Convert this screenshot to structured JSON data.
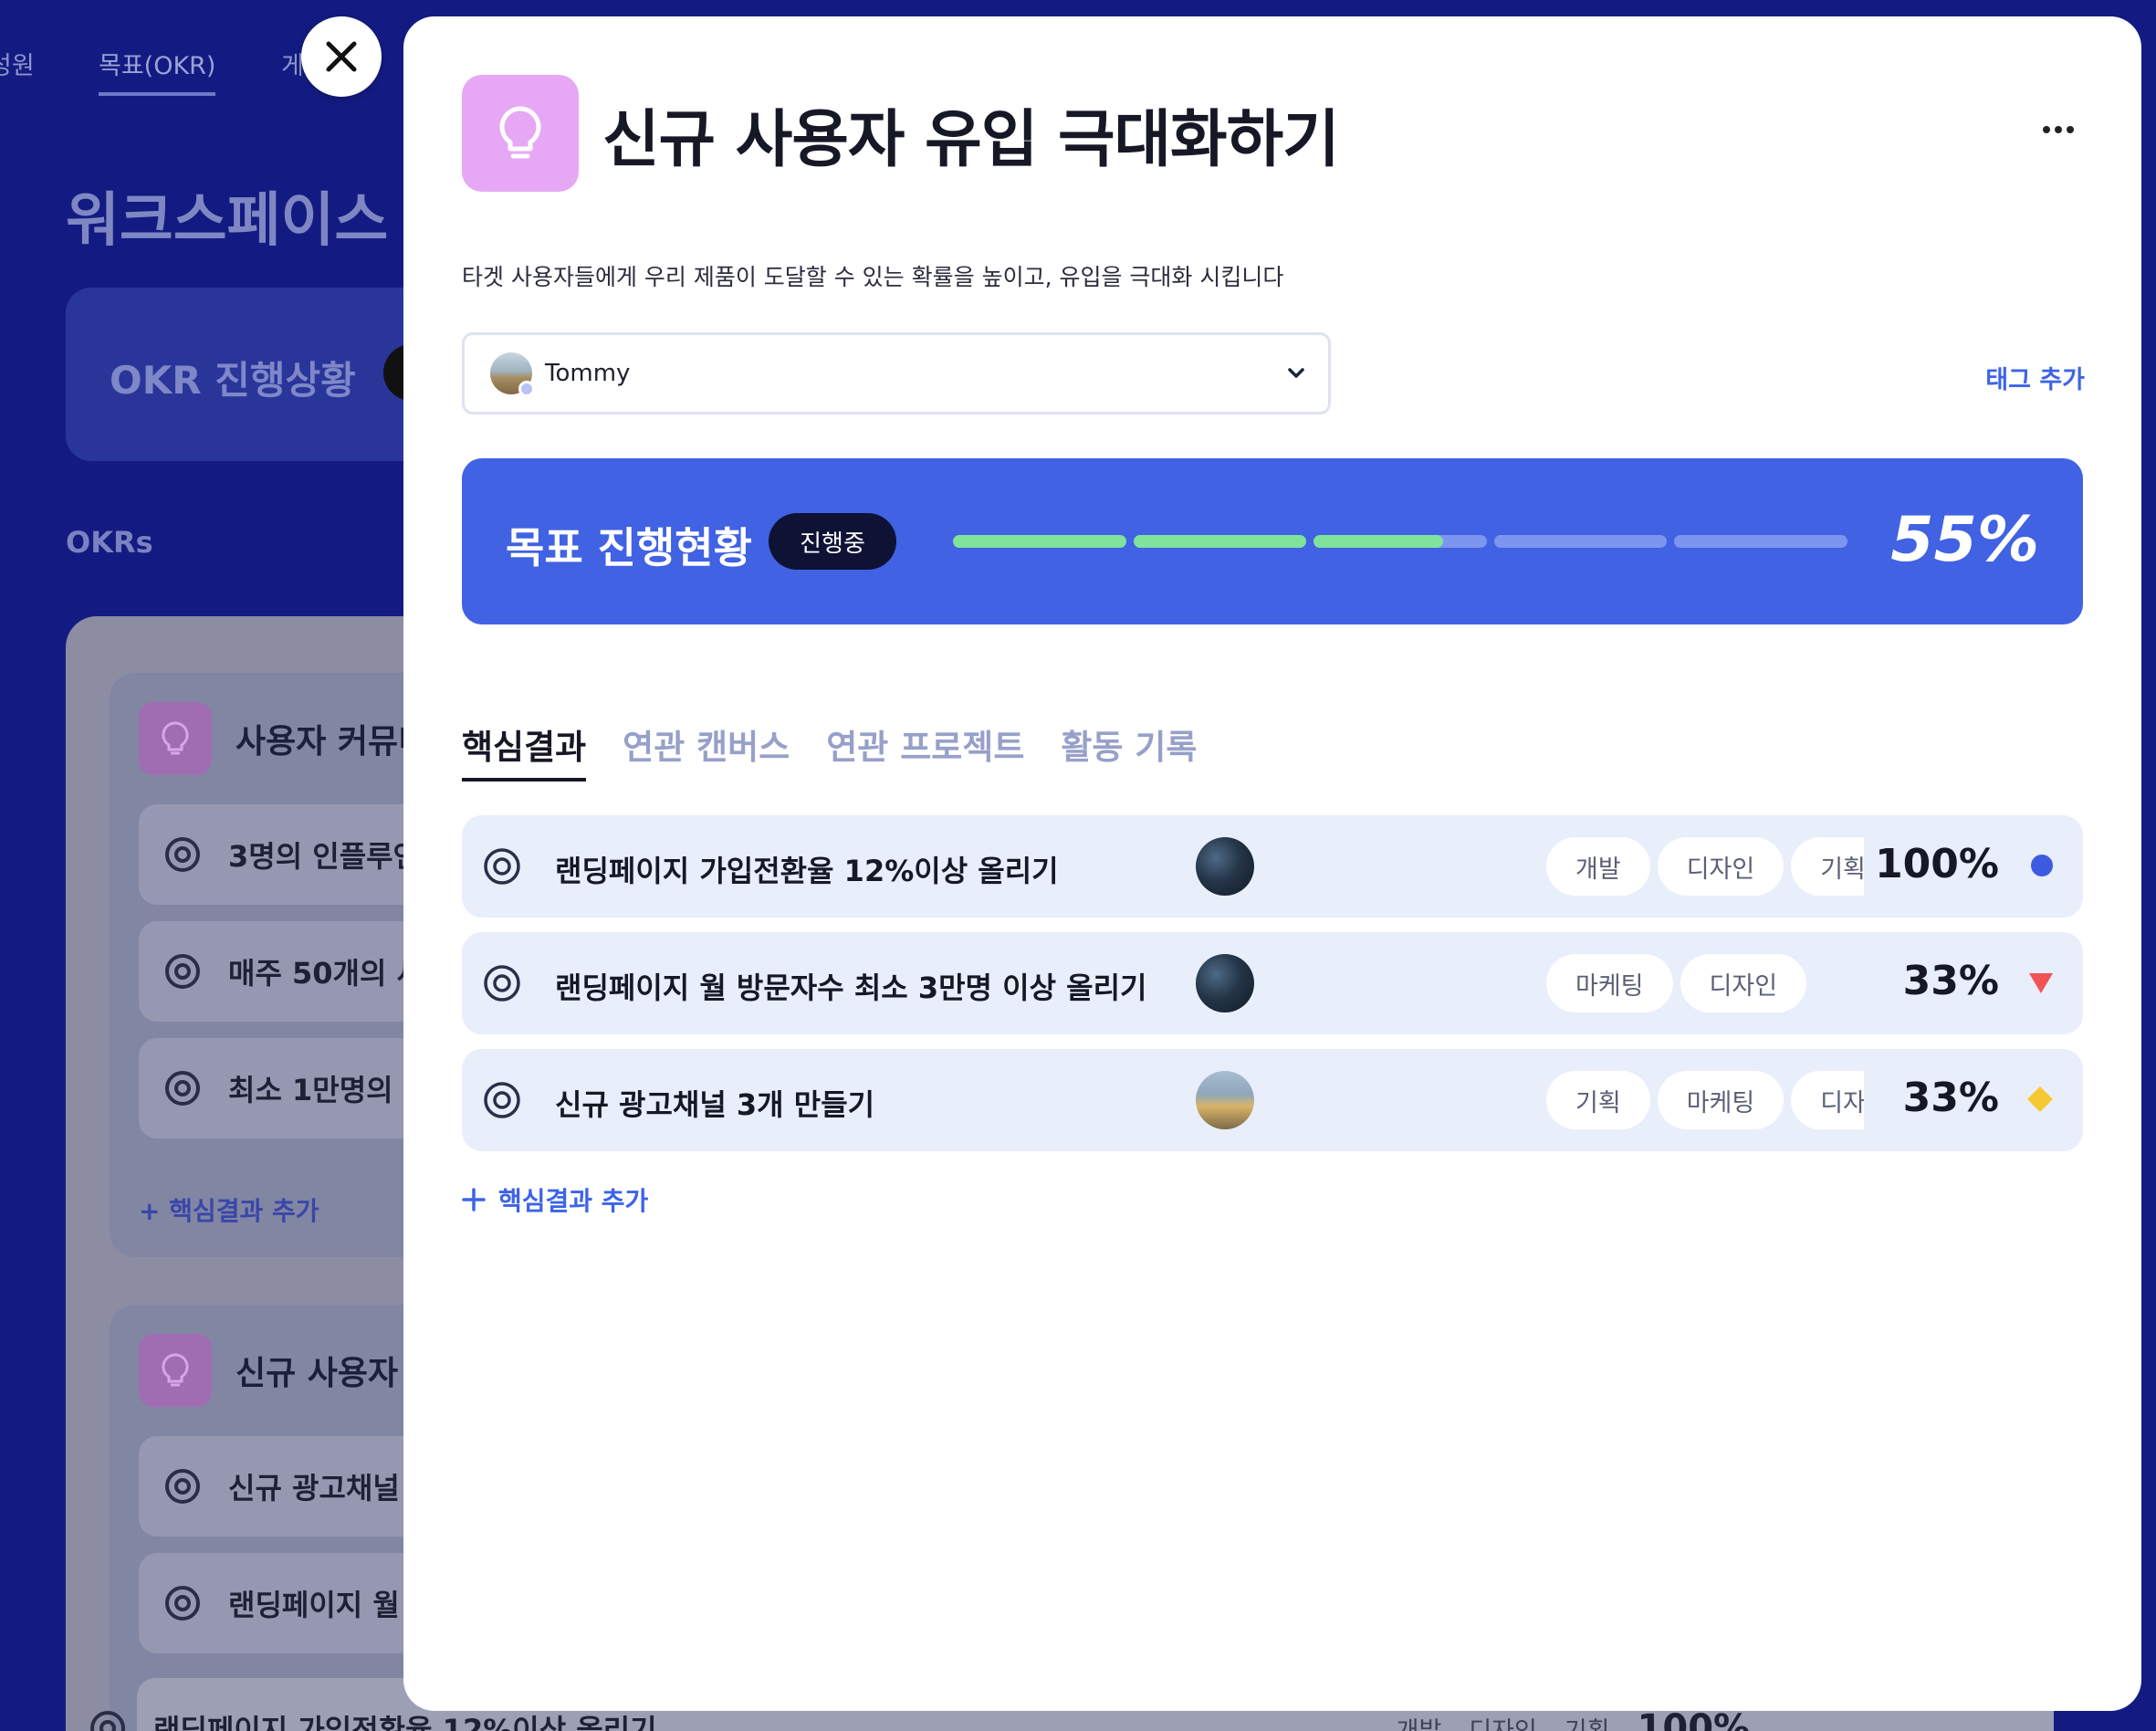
{
  "background": {
    "nav": {
      "item1": "성원",
      "item2": "목표(OKR)",
      "item3": "게"
    },
    "workspace_title": "워크스페이스",
    "okr_status_card": "OKR 진행상황",
    "okrs_label": "OKRs",
    "groups": [
      {
        "title": "사용자 커뮤니",
        "krs": [
          "3명의 인플루언",
          "매주 50개의 새",
          "최소 1만명의"
        ],
        "add_label": "핵심결과 추가"
      },
      {
        "title": "신규 사용자",
        "krs": [
          "신규 광고채널",
          "랜딩페이지 월",
          "랜딩페이지 가입전환율 12%이상 올리기"
        ]
      }
    ],
    "bottom_row": {
      "tags": [
        "개발",
        "디자인",
        "기획"
      ],
      "percent": "100%"
    }
  },
  "modal": {
    "title": "신규 사용자 유입 극대화하기",
    "description": "타겟 사용자들에게 우리 제품이 도달할 수 있는 확률을 높이고, 유입을 극대화 시킵니다",
    "owner": {
      "name": "Tommy"
    },
    "tag_add": "태그 추가",
    "progress": {
      "title": "목표 진행현황",
      "badge": "진행중",
      "percent_label": "55%",
      "value": 0.55,
      "segments": 5,
      "fill_color": "#7fe39b"
    },
    "tabs": [
      "핵심결과",
      "연관 캔버스",
      "연관 프로젝트",
      "활동 기록"
    ],
    "key_results": [
      {
        "title": "랜딩페이지 가입전환율 12%이상 올리기",
        "tags": [
          "개발",
          "디자인",
          "기획"
        ],
        "percent": "100%",
        "status": "blue-circle",
        "status_color": "#3d5be0"
      },
      {
        "title": "랜딩페이지 월 방문자수 최소 3만명 이상 올리기",
        "tags": [
          "마케팅",
          "디자인"
        ],
        "percent": "33%",
        "status": "red-triangle",
        "status_color": "#f05454"
      },
      {
        "title": "신규 광고채널 3개 만들기",
        "tags": [
          "기획",
          "마케팅",
          "디자인"
        ],
        "percent": "33%",
        "status": "yellow-diamond",
        "status_color": "#f5c932"
      }
    ],
    "add_kr": "핵심결과 추가"
  },
  "colors": {
    "background": "#131b82",
    "accent": "#4062e3",
    "progress_fill": "#7fe39b",
    "icon_bg": "#e6a8f5"
  }
}
